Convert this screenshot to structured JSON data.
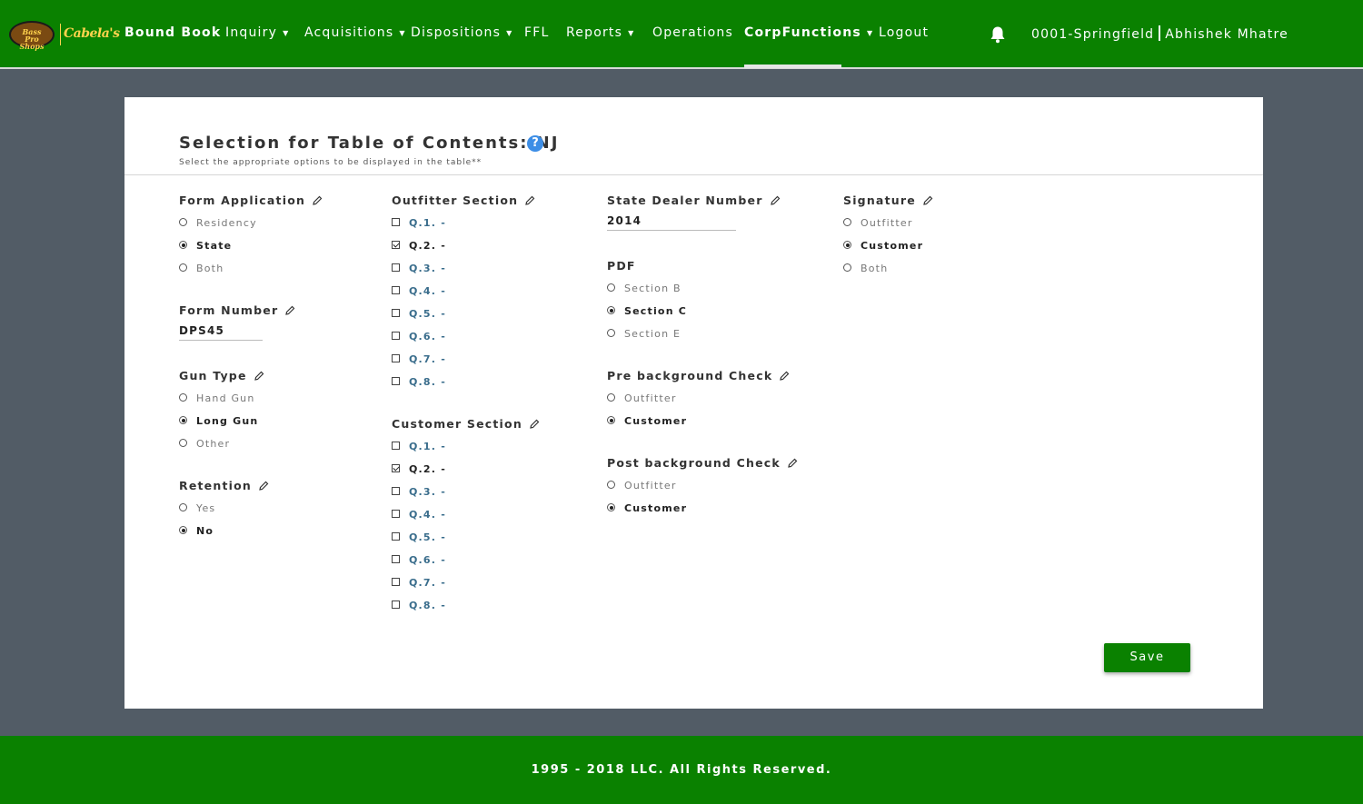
{
  "nav": {
    "logo_left": "Bass Pro Shops",
    "logo_right": "Cabela's",
    "items": [
      {
        "label": "Bound Book",
        "caret": false,
        "bold": true
      },
      {
        "label": "Inquiry",
        "caret": true
      },
      {
        "label": "Acquisitions",
        "caret": true
      },
      {
        "label": "Dispositions",
        "caret": true
      },
      {
        "label": "FFL",
        "caret": false
      },
      {
        "label": "Reports",
        "caret": true
      },
      {
        "label": "Operations",
        "caret": false
      },
      {
        "label": "CorpFunctions",
        "caret": true,
        "bold": true,
        "active": true
      },
      {
        "label": "Logout",
        "caret": false
      }
    ],
    "icon": "bell-icon",
    "store": "0001-Springfield",
    "user": "Abhishek Mhatre"
  },
  "card": {
    "title": "Selection for Table of Contents: NJ",
    "help_icon": "?",
    "subtitle": "Select the appropriate options to be displayed in the table**"
  },
  "form_application": {
    "label": "Form Application",
    "options": [
      "Residency",
      "State",
      "Both"
    ],
    "selected": "State"
  },
  "form_number": {
    "label": "Form Number",
    "value": "DPS45"
  },
  "gun_type": {
    "label": "Gun Type",
    "options": [
      "Hand Gun",
      "Long Gun",
      "Other"
    ],
    "selected": "Long Gun"
  },
  "retention": {
    "label": "Retention",
    "options": [
      "Yes",
      "No"
    ],
    "selected": "No"
  },
  "outfitter_section": {
    "label": "Outfitter Section",
    "items": [
      {
        "label": "Q.1. -",
        "checked": false
      },
      {
        "label": "Q.2. -",
        "checked": true
      },
      {
        "label": "Q.3. -",
        "checked": false
      },
      {
        "label": "Q.4. -",
        "checked": false
      },
      {
        "label": "Q.5. -",
        "checked": false
      },
      {
        "label": "Q.6. -",
        "checked": false
      },
      {
        "label": "Q.7. -",
        "checked": false
      },
      {
        "label": "Q.8. -",
        "checked": false
      }
    ]
  },
  "customer_section": {
    "label": "Customer Section",
    "items": [
      {
        "label": "Q.1. -",
        "checked": false
      },
      {
        "label": "Q.2. -",
        "checked": true
      },
      {
        "label": "Q.3. -",
        "checked": false
      },
      {
        "label": "Q.4. -",
        "checked": false
      },
      {
        "label": "Q.5. -",
        "checked": false
      },
      {
        "label": "Q.6. -",
        "checked": false
      },
      {
        "label": "Q.7. -",
        "checked": false
      },
      {
        "label": "Q.8. -",
        "checked": false
      }
    ]
  },
  "state_dealer_number": {
    "label": "State Dealer Number",
    "value": "2014"
  },
  "pdf": {
    "label": "PDF",
    "options": [
      "Section B",
      "Section C",
      "Section E"
    ],
    "selected": "Section C"
  },
  "pre_background_check": {
    "label": "Pre background Check",
    "options": [
      "Outfitter",
      "Customer"
    ],
    "selected": "Customer"
  },
  "post_background_check": {
    "label": "Post background Check",
    "options": [
      "Outfitter",
      "Customer"
    ],
    "selected": "Customer"
  },
  "signature": {
    "label": "Signature",
    "options": [
      "Outfitter",
      "Customer",
      "Both"
    ],
    "selected": "Customer"
  },
  "actions": {
    "save_label": "Save"
  },
  "footer": {
    "text": "1995 - 2018 LLC. All Rights Reserved."
  },
  "colors": {
    "brand_green": "#0a8100",
    "help_blue": "#3d8ee6",
    "page_bg": "#525c66"
  }
}
